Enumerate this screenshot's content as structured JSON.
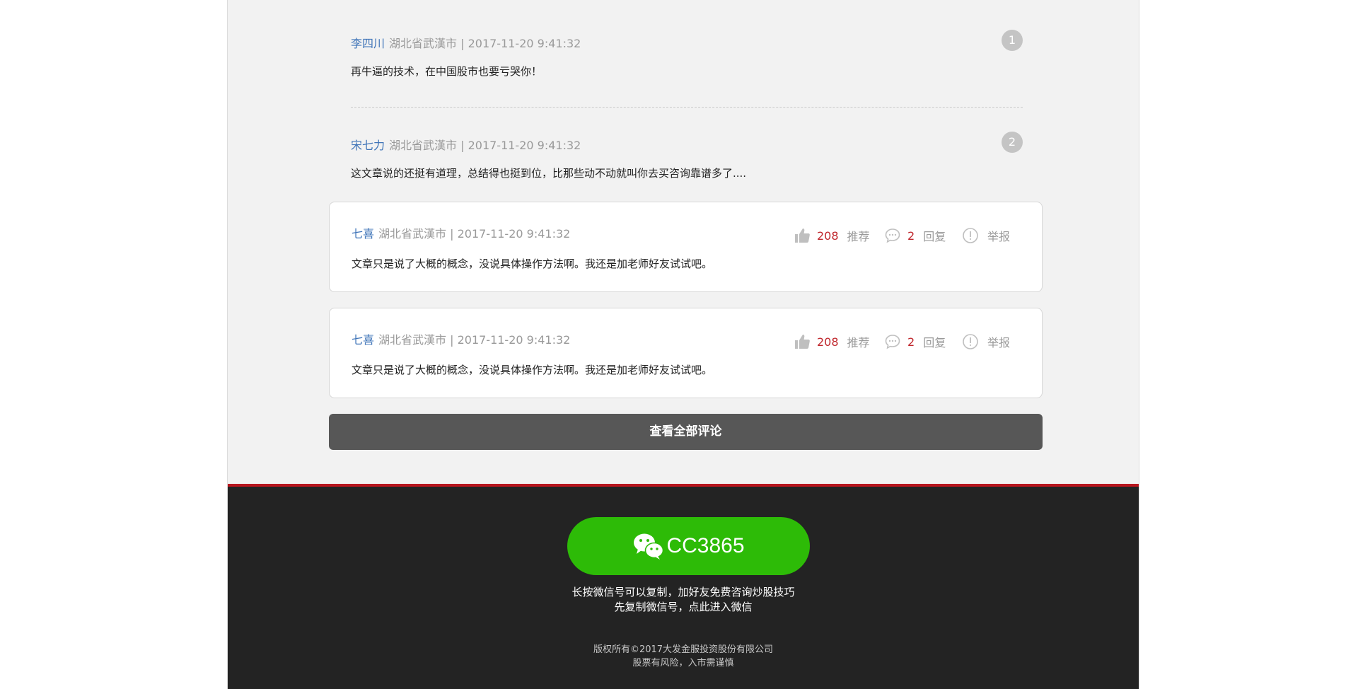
{
  "plain_comments": [
    {
      "username": "李四川",
      "meta": "湖北省武漢市 | 2017-11-20 9:41:32",
      "text": "再牛逼的技术，在中国股市也要亏哭你！",
      "rank": "1"
    },
    {
      "username": "宋七力",
      "meta": "湖北省武漢市 | 2017-11-20 9:41:32",
      "text": "这文章说的还挺有道理，总结得也挺到位，比那些动不动就叫你去买咨询靠谱多了....",
      "rank": "2"
    }
  ],
  "card_comments": [
    {
      "username": "七喜",
      "meta": "湖北省武漢市 | 2017-11-20 9:41:32",
      "text": "文章只是说了大概的概念，没说具体操作方法啊。我还是加老师好友试试吧。",
      "likes": "208",
      "like_label": "推荐",
      "replies": "2",
      "reply_label": "回复",
      "report_label": "举报"
    },
    {
      "username": "七喜",
      "meta": "湖北省武漢市 | 2017-11-20 9:41:32",
      "text": "文章只是说了大概的概念，没说具体操作方法啊。我还是加老师好友试试吧。",
      "likes": "208",
      "like_label": "推荐",
      "replies": "2",
      "reply_label": "回复",
      "report_label": "举报"
    }
  ],
  "view_all_label": "查看全部评论",
  "footer": {
    "wechat_id": "CC3865",
    "hint_line1": "长按微信号可以复制，加好友免费咨询炒股技巧",
    "hint_line2": "先复制微信号，点此进入微信",
    "copyright": "版权所有©2017大发金服投资股份有限公司",
    "risk": "股票有风险，入市需谨慎"
  },
  "colors": {
    "username": "#3f74b8",
    "count_red": "#c0272d",
    "wechat_green": "#2dbb07",
    "footer_bg": "#232323",
    "accent_red": "#b8161e"
  },
  "icons": [
    "thumbs-up-icon",
    "comment-bubble-icon",
    "report-exclamation-icon",
    "wechat-icon"
  ]
}
